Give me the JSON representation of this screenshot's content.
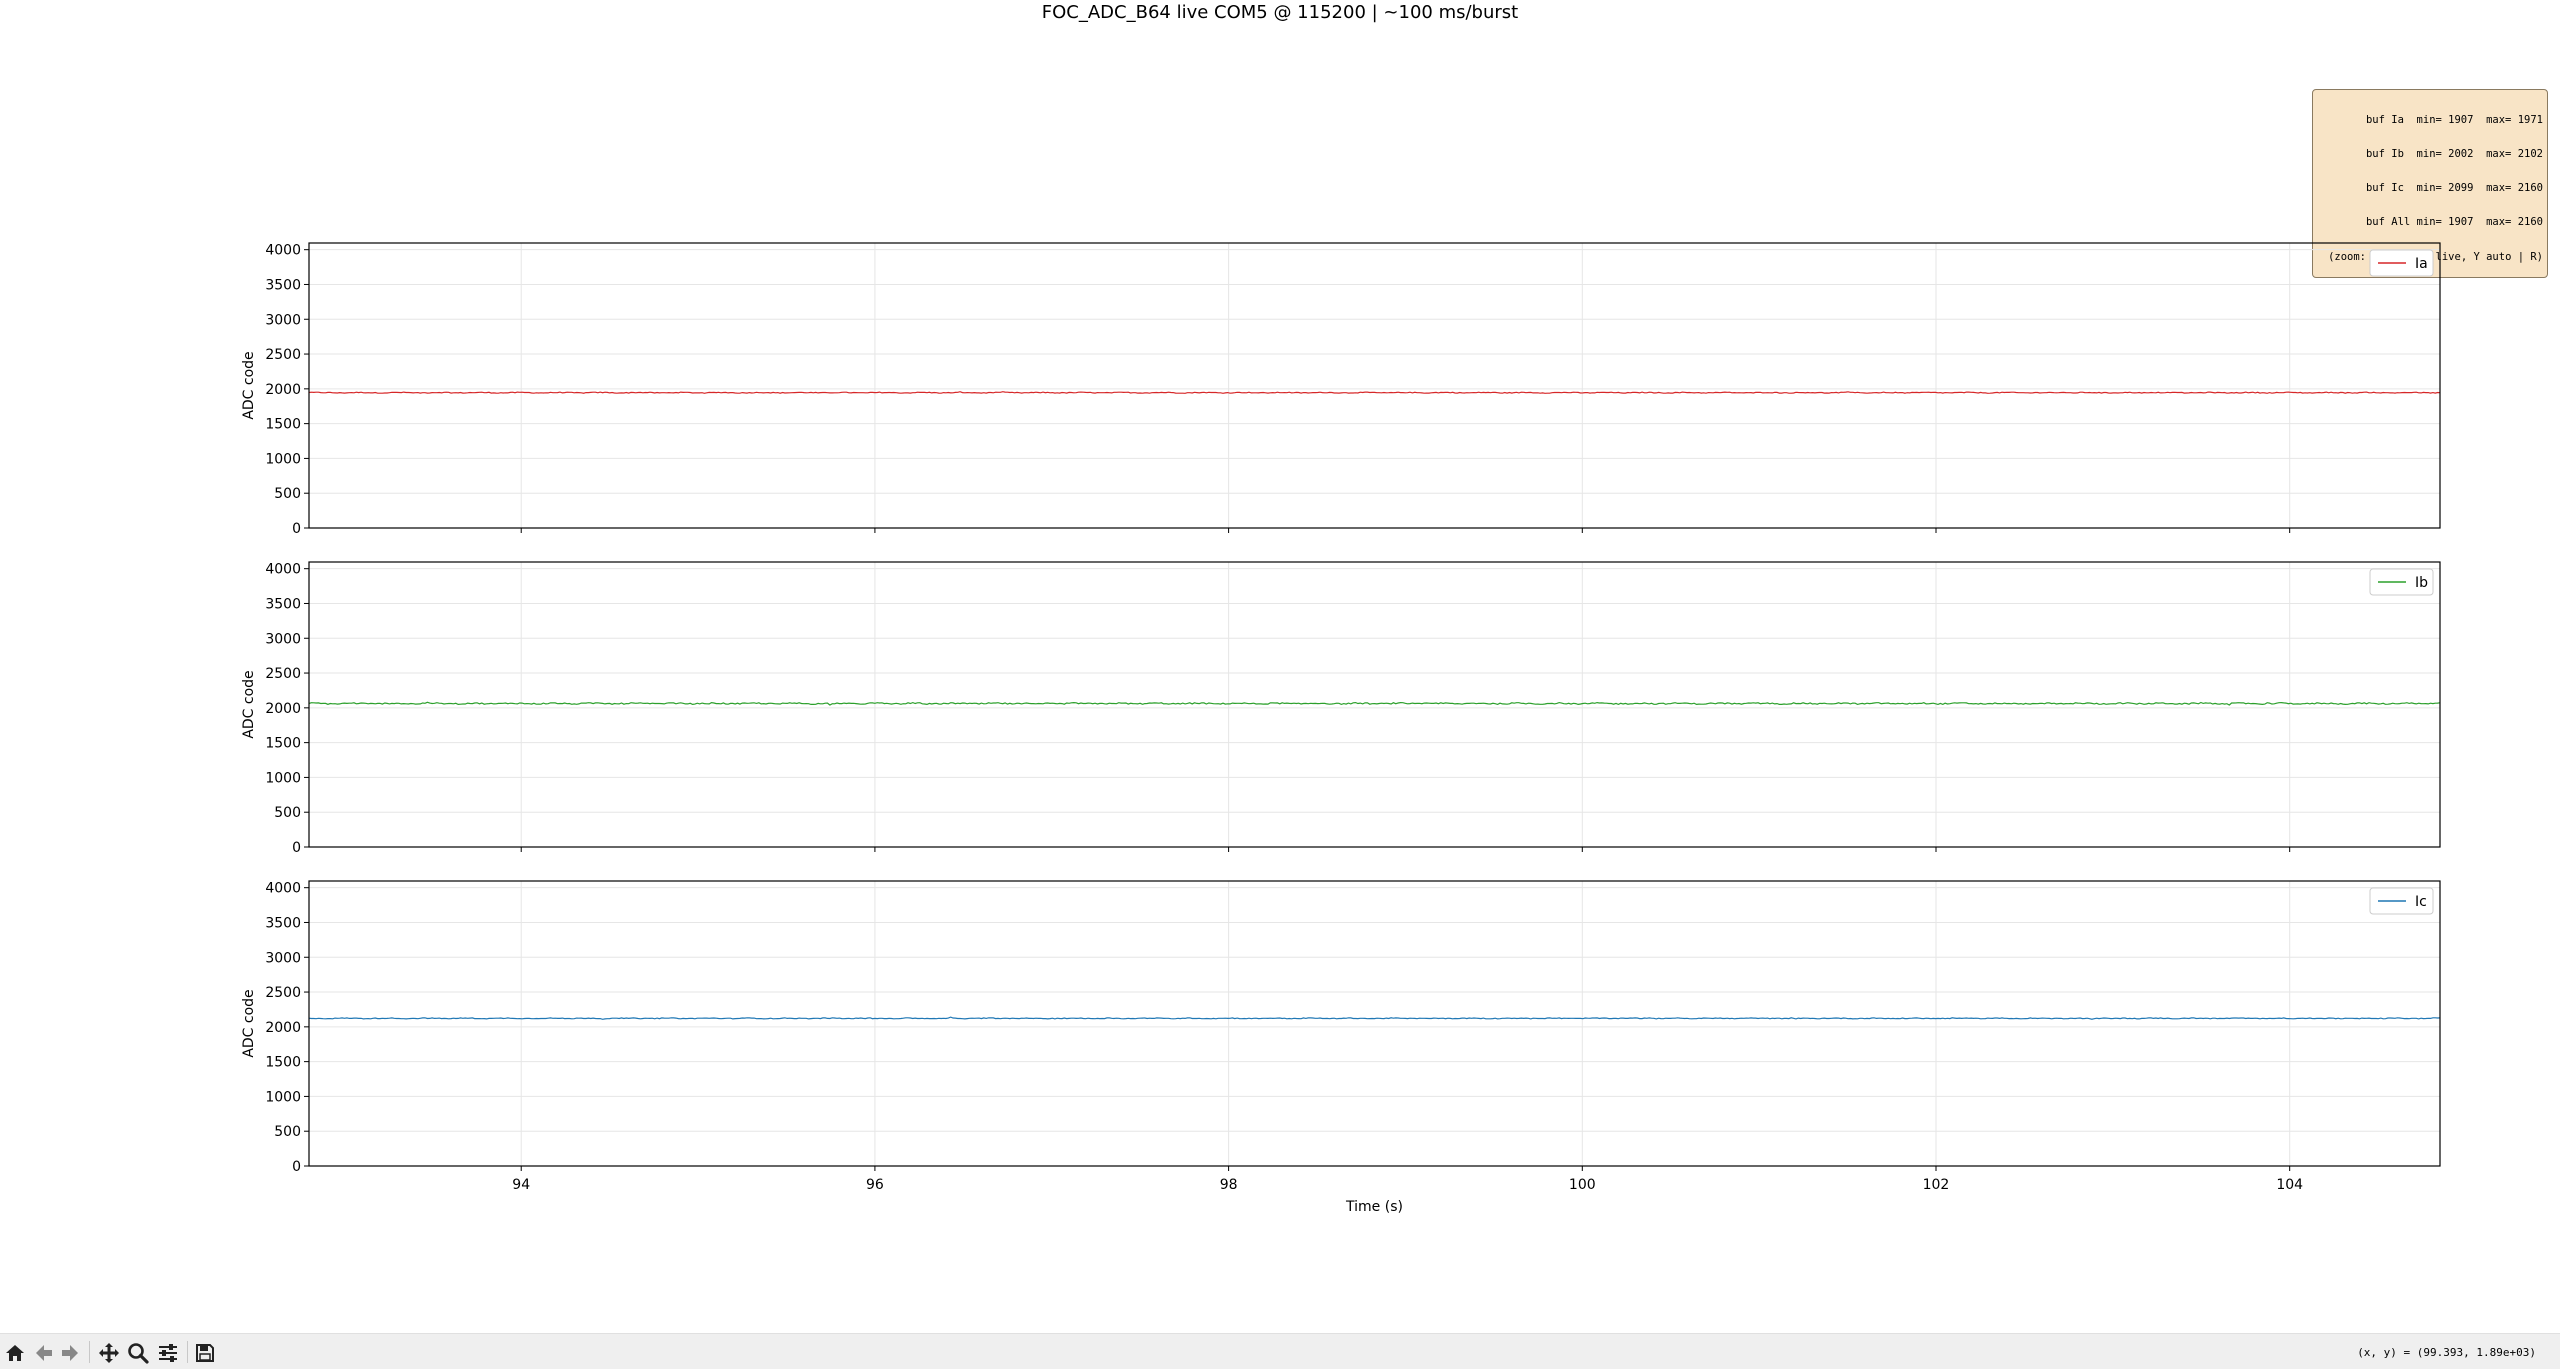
{
  "window_title": "FOC_ADC_B64 live COM5 @ 115200 | ~100 ms/burst",
  "stats_box": {
    "lines": [
      "buf Ia  min= 1907  max= 1971",
      "buf Ib  min= 2002  max= 2102",
      "buf Ic  min= 2099  max= 2160",
      "buf All min= 1907  max= 2160",
      "(zoom: X follows live, Y auto | R)"
    ]
  },
  "toolbar": {
    "icons": [
      "home-icon",
      "back-icon",
      "forward-icon",
      "pan-icon",
      "zoom-icon",
      "configure-icon",
      "save-icon"
    ],
    "coords_readout": "(x, y) = (99.393, 1.89e+03)"
  },
  "chart_data": [
    {
      "type": "line",
      "ylabel": "ADC code",
      "xlabel": "",
      "xlim": [
        92.8,
        104.85
      ],
      "ylim": [
        0,
        4096
      ],
      "xticks": [
        94,
        96,
        98,
        100,
        102,
        104
      ],
      "yticks": [
        0,
        500,
        1000,
        1500,
        2000,
        2500,
        3000,
        3500,
        4000
      ],
      "grid": true,
      "legend": "top-right",
      "series": [
        {
          "name": "Ia",
          "color": "#d62728",
          "mean": 1945,
          "min": 1907,
          "max": 1971
        }
      ]
    },
    {
      "type": "line",
      "ylabel": "ADC code",
      "xlabel": "",
      "xlim": [
        92.8,
        104.85
      ],
      "ylim": [
        0,
        4096
      ],
      "xticks": [
        94,
        96,
        98,
        100,
        102,
        104
      ],
      "yticks": [
        0,
        500,
        1000,
        1500,
        2000,
        2500,
        3000,
        3500,
        4000
      ],
      "grid": true,
      "legend": "top-right",
      "series": [
        {
          "name": "Ib",
          "color": "#2ca02c",
          "mean": 2062,
          "min": 2002,
          "max": 2102
        }
      ]
    },
    {
      "type": "line",
      "ylabel": "ADC code",
      "xlabel": "Time (s)",
      "xlim": [
        92.8,
        104.85
      ],
      "ylim": [
        0,
        4096
      ],
      "xticks": [
        94,
        96,
        98,
        100,
        102,
        104
      ],
      "yticks": [
        0,
        500,
        1000,
        1500,
        2000,
        2500,
        3000,
        3500,
        4000
      ],
      "grid": true,
      "legend": "top-right",
      "series": [
        {
          "name": "Ic",
          "color": "#1f77b4",
          "mean": 2122,
          "min": 2099,
          "max": 2160
        }
      ]
    }
  ]
}
